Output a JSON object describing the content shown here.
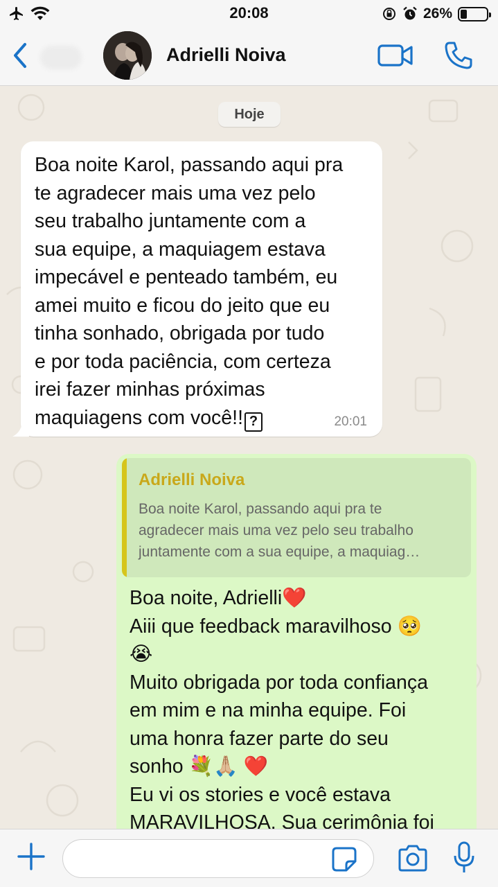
{
  "status_bar": {
    "time": "20:08",
    "battery_percent": "26%",
    "battery_level": 0.26
  },
  "header": {
    "contact_name": "Adrielli Noiva"
  },
  "chat": {
    "date_chip": "Hoje",
    "incoming": {
      "text": "Boa noite Karol, passando aqui pra\nte agradecer mais uma vez pelo\nseu trabalho juntamente com a\nsua equipe, a maquiagem estava\nimpecável e penteado também, eu\namei muito e ficou do jeito que eu\ntinha sonhado, obrigada por tudo\ne por toda paciência, com certeza\nirei fazer minhas próximas\nmaquiagens com você!!",
      "unknown_glyph": "?",
      "time": "20:01"
    },
    "outgoing": {
      "quote_author": "Adrielli Noiva",
      "quote_text": "Boa noite Karol, passando aqui pra te\nagradecer mais uma vez pelo seu trabalho\njuntamente com a sua equipe, a maquiag…",
      "line1": "Boa noite, Adrielli",
      "line2": "Aiii que feedback maravilhoso",
      "line3": "Muito obrigada por toda confiança\nem mim e na minha equipe. Foi\numa honra fazer parte do seu",
      "line4": "sonho",
      "line5": "Eu vi os stories e você estava\nMARAVILHOSA. Sua cerimônia foi",
      "emoji_heart": "❤️",
      "emoji_pleading": "🥺",
      "emoji_crying": "😭",
      "emoji_bouquet": "💐",
      "emoji_pray": "🙏🏼"
    }
  },
  "icons": {
    "back": "chevron-left-icon",
    "video": "video-camera-icon",
    "call": "phone-icon",
    "plus": "plus-icon",
    "sticker": "sticker-icon",
    "camera": "camera-icon",
    "mic": "microphone-icon"
  },
  "colors": {
    "accent": "#1a73c8",
    "incoming_bubble": "#ffffff",
    "outgoing_bubble": "#dcf8c6",
    "quote_bar": "#d6c51c",
    "chat_background": "#efeae2"
  }
}
